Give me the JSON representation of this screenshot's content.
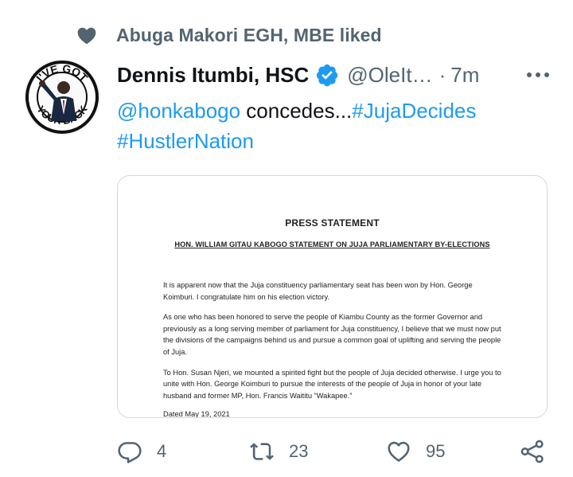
{
  "social_context": {
    "text": "Abuga Makori EGH, MBE liked",
    "icon": "heart-filled-icon"
  },
  "author": {
    "display_name": "Dennis Itumbi, HSC",
    "verified": true,
    "handle": "@OleIt…",
    "separator": "·",
    "time": "7m",
    "avatar_text_top": "I'VE GOT",
    "avatar_text_bottom": "YOUR BACK"
  },
  "tweet": {
    "mention": "@honkabogo",
    "text": " concedes...",
    "hashtag1": "#JujaDecides",
    "hashtag2": "#HustlerNation"
  },
  "media": {
    "title": "PRESS STATEMENT",
    "subtitle": "HON. WILLIAM GITAU KABOGO STATEMENT ON JUJA PARLIAMENTARY BY-ELECTIONS",
    "paragraphs": [
      "It is apparent now that the Juja constituency parliamentary seat has been won by Hon. George Koimburi. I congratulate him on his election victory.",
      "As one who has been honored to serve the people of Kiambu County as the former Governor and previously as a long serving member of parliament for Juja constituency, I believe that we must now put the divisions of the campaigns behind us and pursue a common goal of uplifting and serving the people of Juja.",
      "To Hon. Susan Njeri, we mounted a spirited fight but the people of Juja decided otherwise. I urge you to unite with Hon. George Koimburi to pursue the interests of the people of Juja in honor of your late husband and former MP, Hon. Francis Waititu “Wakapee.”"
    ],
    "date": "Dated May 19, 2021"
  },
  "actions": {
    "reply_count": "4",
    "retweet_count": "23",
    "like_count": "95"
  },
  "colors": {
    "link": "#1d9bf0",
    "secondary_text": "#536471",
    "verified_badge": "#1d9bf0",
    "border": "#cfd9de"
  }
}
